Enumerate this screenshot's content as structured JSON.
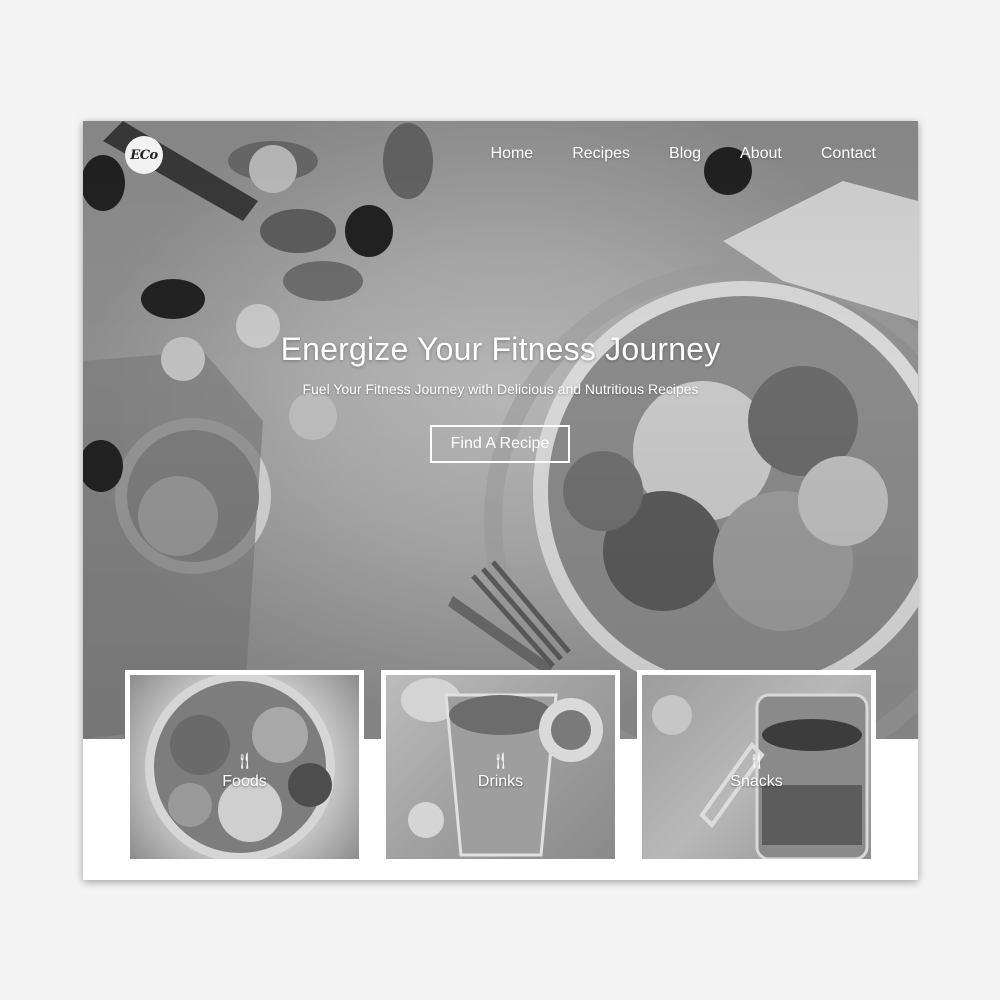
{
  "logo": {
    "text": "ECo"
  },
  "nav": {
    "items": [
      "Home",
      "Recipes",
      "Blog",
      "About",
      "Contact"
    ]
  },
  "hero": {
    "title": "Energize Your Fitness Journey",
    "subtitle": "Fuel Your Fitness Journey with Delicious and Nutritious Recipes",
    "cta_label": "Find A Recipe"
  },
  "categories": [
    {
      "label": "Foods",
      "icon": "utensils-icon"
    },
    {
      "label": "Drinks",
      "icon": "utensils-icon"
    },
    {
      "label": "Snacks",
      "icon": "utensils-icon"
    }
  ],
  "colors": {
    "page_background": "#f4f4f4",
    "card_background": "#ffffff",
    "text_on_hero": "#ffffff"
  }
}
